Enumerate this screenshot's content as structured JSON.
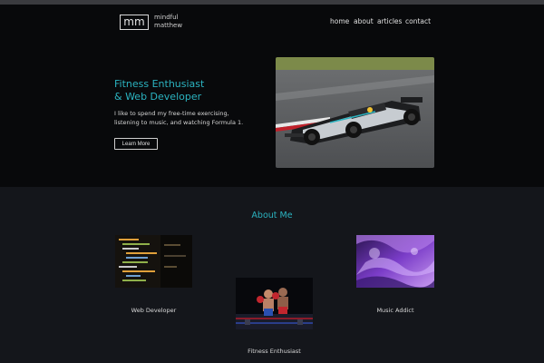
{
  "header": {
    "logo_mark": "mm",
    "logo_line1": "mindful",
    "logo_line2": "matthew",
    "nav": [
      "home",
      "about",
      "articles",
      "contact"
    ]
  },
  "hero": {
    "headline_line1": "Fitness Enthusiast",
    "headline_line2": "& Web Developer",
    "intro_line1": "I like to spend my free-time exercising,",
    "intro_line2": "listening to music, and watching Formula 1.",
    "button_label": "Learn More",
    "image": "formula-1-race-car-photo"
  },
  "about": {
    "title": "About Me",
    "cards": [
      {
        "label": "Web Developer",
        "image": "code-editor-photo"
      },
      {
        "label": "Fitness Enthusiast",
        "image": "boxing-match-photo"
      },
      {
        "label": "Music Addict",
        "image": "purple-abstract-photo"
      }
    ]
  },
  "colors": {
    "accent": "#2bb3c0",
    "hero_bg": "#08090b",
    "page_bg": "#14161b"
  }
}
